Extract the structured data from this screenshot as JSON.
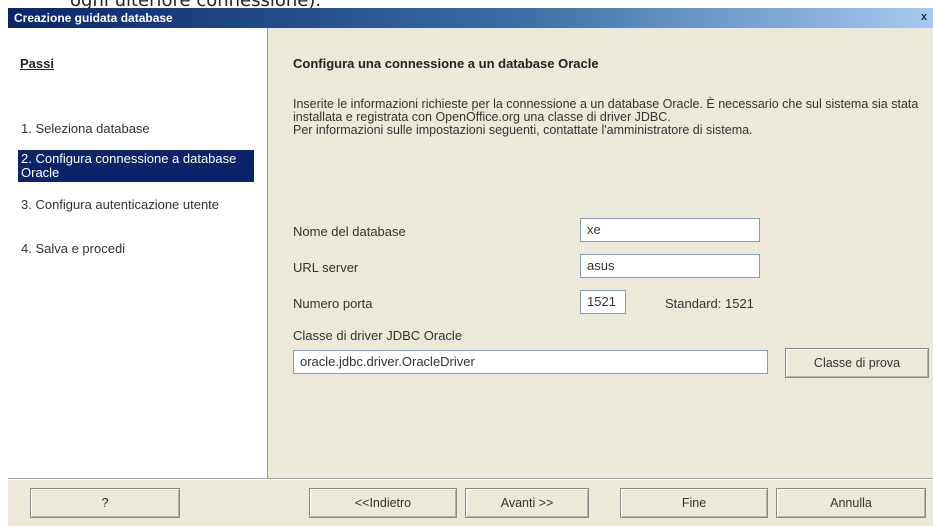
{
  "top_fragment": "ogni ulteriore connessione).",
  "window": {
    "title": "Creazione guidata database",
    "close_glyph": "x"
  },
  "steps": {
    "title": "Passi",
    "items": [
      {
        "label": "1. Seleziona database"
      },
      {
        "label": "2. Configura connessione a database Oracle"
      },
      {
        "label": "3. Configura autenticazione utente"
      },
      {
        "label": "4. Salva e procedi"
      }
    ]
  },
  "main": {
    "heading": "Configura una connessione a un database Oracle",
    "desc_line1": "Inserite le informazioni richieste per la connessione a un database Oracle. È necessario che sul sistema sia stata installata e registrata con OpenOffice.org una classe di driver JDBC.",
    "desc_line2": "Per informazioni sulle impostazioni seguenti, contattate l'amministratore di sistema.",
    "db_name_label": "Nome del database",
    "db_name_value": "xe",
    "server_url_label": "URL server",
    "server_url_value": "asus",
    "port_label": "Numero porta",
    "port_value": "1521",
    "port_default": "Standard: 1521",
    "driver_label": "Classe di driver JDBC Oracle",
    "driver_value": "oracle.jdbc.driver.OracleDriver",
    "test_class_button": "Classe di prova"
  },
  "footer": {
    "help": "?",
    "back": "<<Indietro",
    "next": "Avanti >>",
    "finish": "Fine",
    "cancel": "Annulla"
  }
}
